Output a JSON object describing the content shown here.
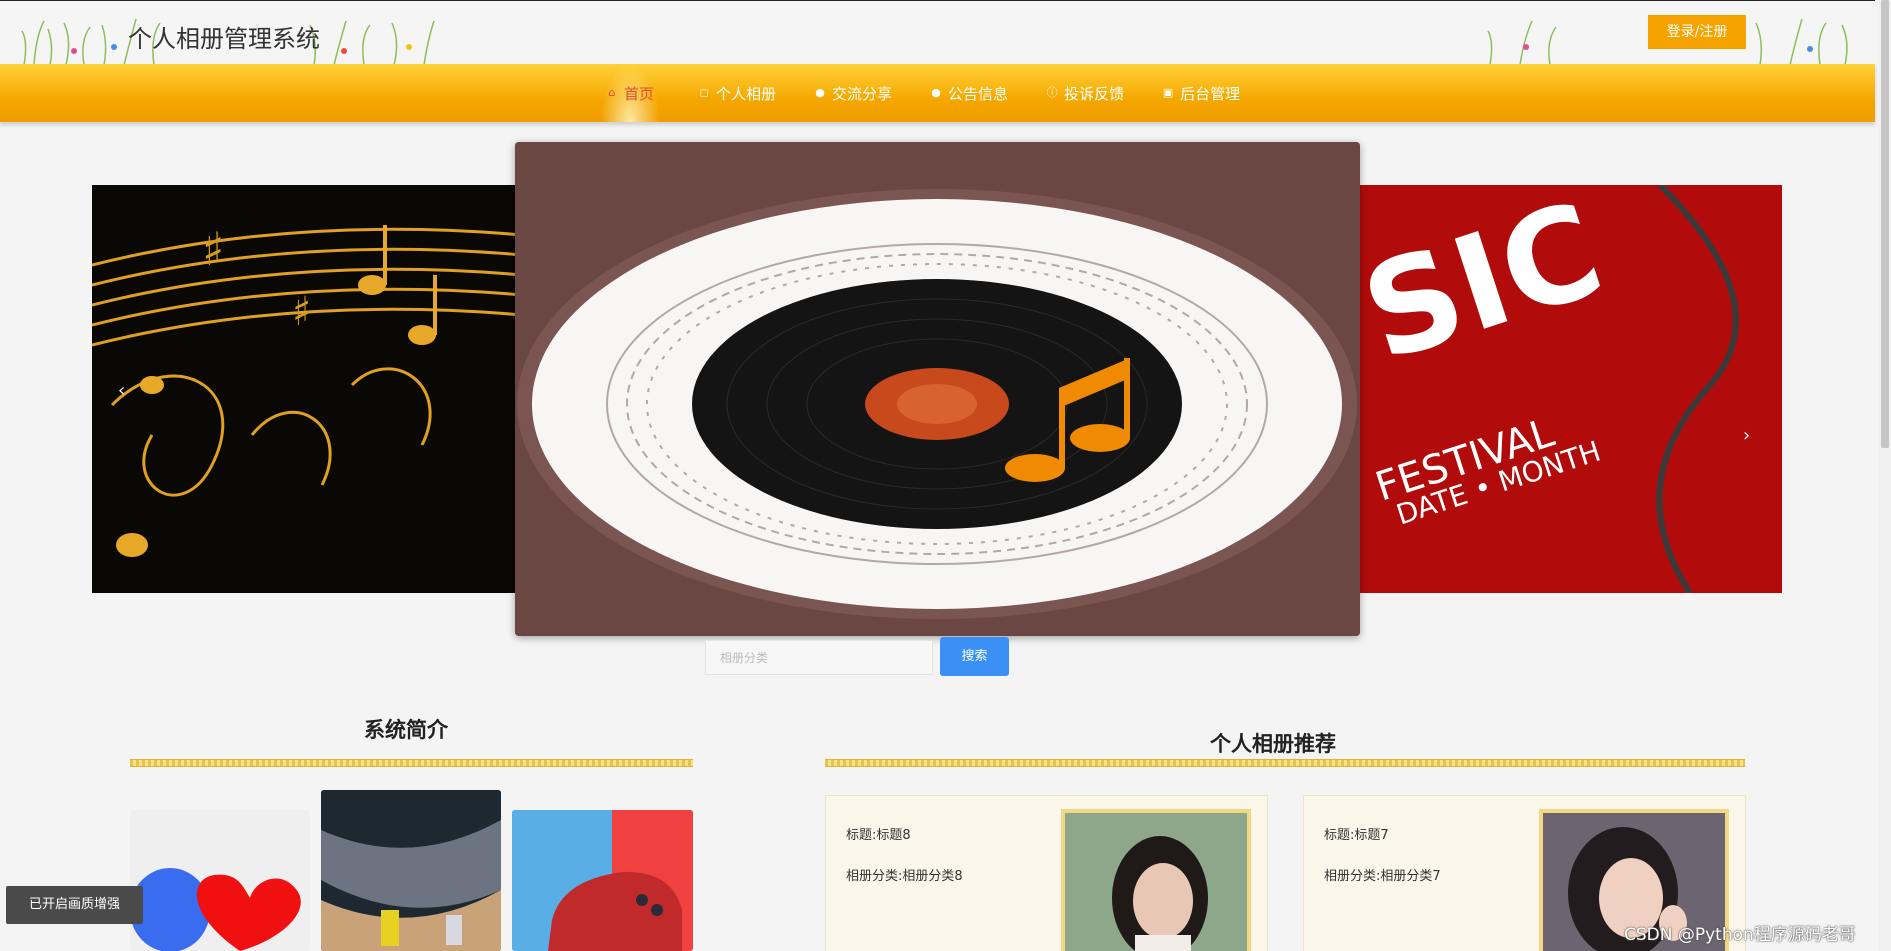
{
  "header": {
    "site_title": "个人相册管理系统",
    "login_label": "登录/注册"
  },
  "nav": {
    "items": [
      {
        "label": "首页",
        "icon": "home-icon",
        "active": true
      },
      {
        "label": "个人相册",
        "icon": "bag-icon"
      },
      {
        "label": "交流分享",
        "icon": "dot-icon"
      },
      {
        "label": "公告信息",
        "icon": "dot-icon"
      },
      {
        "label": "投诉反馈",
        "icon": "info-icon"
      },
      {
        "label": "后台管理",
        "icon": "admin-icon"
      }
    ]
  },
  "carousel": {
    "prev": "‹",
    "next": "›",
    "right_slide_text": {
      "big": "SIC",
      "line1": "FESTIVAL",
      "line2": "DATE • MONTH"
    }
  },
  "search": {
    "placeholder": "相册分类",
    "button_label": "搜索"
  },
  "intro": {
    "title": "系统简介"
  },
  "recommend": {
    "title": "个人相册推荐",
    "cards": [
      {
        "title": "标题:标题8",
        "category": "相册分类:相册分类8"
      },
      {
        "title": "标题:标题7",
        "category": "相册分类:相册分类7"
      }
    ]
  },
  "overlay": {
    "badge": "已开启画质增强",
    "watermark": "CSDN @Python程序源码老哥"
  },
  "colors": {
    "accent": "#f6a300",
    "nav_active": "#e84a2c",
    "search_button": "#3a90f5"
  }
}
